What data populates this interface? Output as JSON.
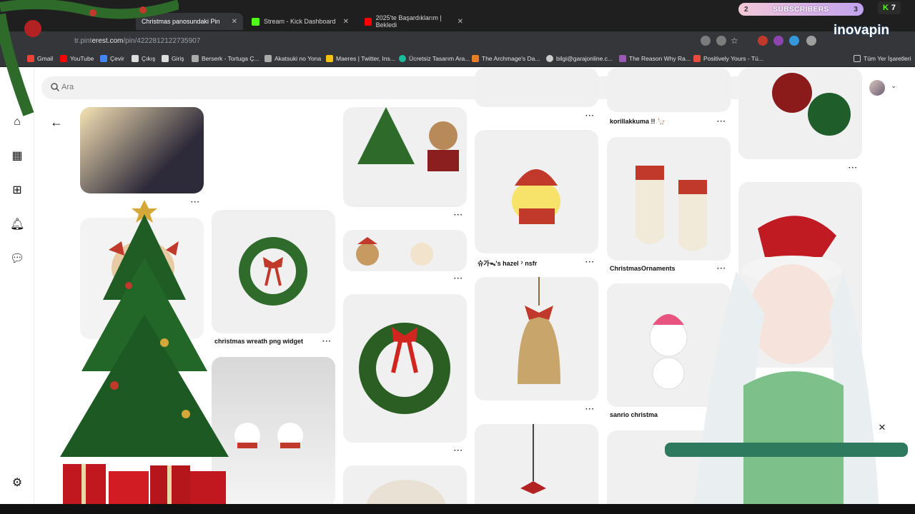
{
  "tabs": [
    {
      "title": "Christmas panosundaki Pin",
      "active": true
    },
    {
      "title": "Stream - Kick Dashboard",
      "active": false
    },
    {
      "title": "2025'te Başardıklarım | Bekledi",
      "active": false
    }
  ],
  "url": {
    "dim": "tr.pint",
    "main": "erest.com",
    "path": "/pin/4222812122735907"
  },
  "bookmarks": [
    "Gmail",
    "YouTube",
    "Çevir",
    "Çıkış",
    "Giriş",
    "Berserk - Tortuga Ç...",
    "Akatsuki no Yona",
    "Maeres | Twitter, Ins...",
    "Ücretsiz Tasarım Ara...",
    "The Archmage's Da...",
    "bilgi@garajonline.c...",
    "The Reason Why Ra...",
    "Positively Yours - Tü..."
  ],
  "all_bookmarks": "Tüm Yer İşaretleri",
  "search": {
    "placeholder": "Ara"
  },
  "pins": {
    "wreath1": "christmas wreath png widget",
    "hazel": "슈가ᯓ's hazel ⁷ nsfr",
    "korilla": "korillakkuma !! 🦙",
    "ornaments": "ChristmasOrnaments",
    "sanrio": "sanrio christma"
  },
  "dots": "···",
  "overlay": {
    "subs_left": "2",
    "subs_label": "SUBSCRIBERS",
    "subs_right": "3",
    "kick_count": "7",
    "brand": "inovapin"
  },
  "icons": {
    "search": "search-icon",
    "back": "back-arrow-icon",
    "home": "home-icon",
    "boards": "boards-icon",
    "create": "create-icon",
    "notifications": "bell-icon",
    "messages": "chat-icon",
    "settings": "gear-icon"
  }
}
